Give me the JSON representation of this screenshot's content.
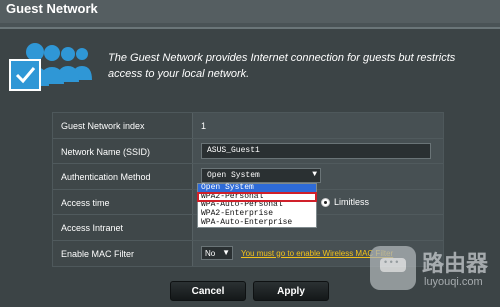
{
  "header": {
    "title": "Guest Network"
  },
  "intro": {
    "text": "The Guest Network provides Internet connection for guests but restricts access to your local network.",
    "icon": "users-check-icon"
  },
  "table": {
    "index": {
      "label": "Guest Network index",
      "value": "1"
    },
    "ssid": {
      "label": "Network Name (SSID)",
      "value": "ASUS_Guest1"
    },
    "auth": {
      "label": "Authentication Method",
      "selected": "Open System",
      "options": [
        "Open System",
        "WPA2-Personal",
        "WPA-Auto-Personal",
        "WPA2-Enterprise",
        "WPA-Auto-Enterprise"
      ],
      "highlighted": "Open System",
      "marked": "WPA2-Personal"
    },
    "access_time": {
      "label": "Access time",
      "radio_label": "Limitless"
    },
    "intranet": {
      "label": "Access Intranet"
    },
    "mac": {
      "label": "Enable MAC Filter",
      "selected": "No",
      "link": "You must go to enable Wireless MAC Filter"
    }
  },
  "buttons": {
    "cancel": "Cancel",
    "apply": "Apply"
  },
  "watermark": {
    "title": "路由器",
    "subtitle": "luyouqi.com"
  },
  "colors": {
    "background": "#3c4446",
    "link": "#f3c21a",
    "highlight": "#2e6bd8",
    "mark": "#d0202a"
  }
}
